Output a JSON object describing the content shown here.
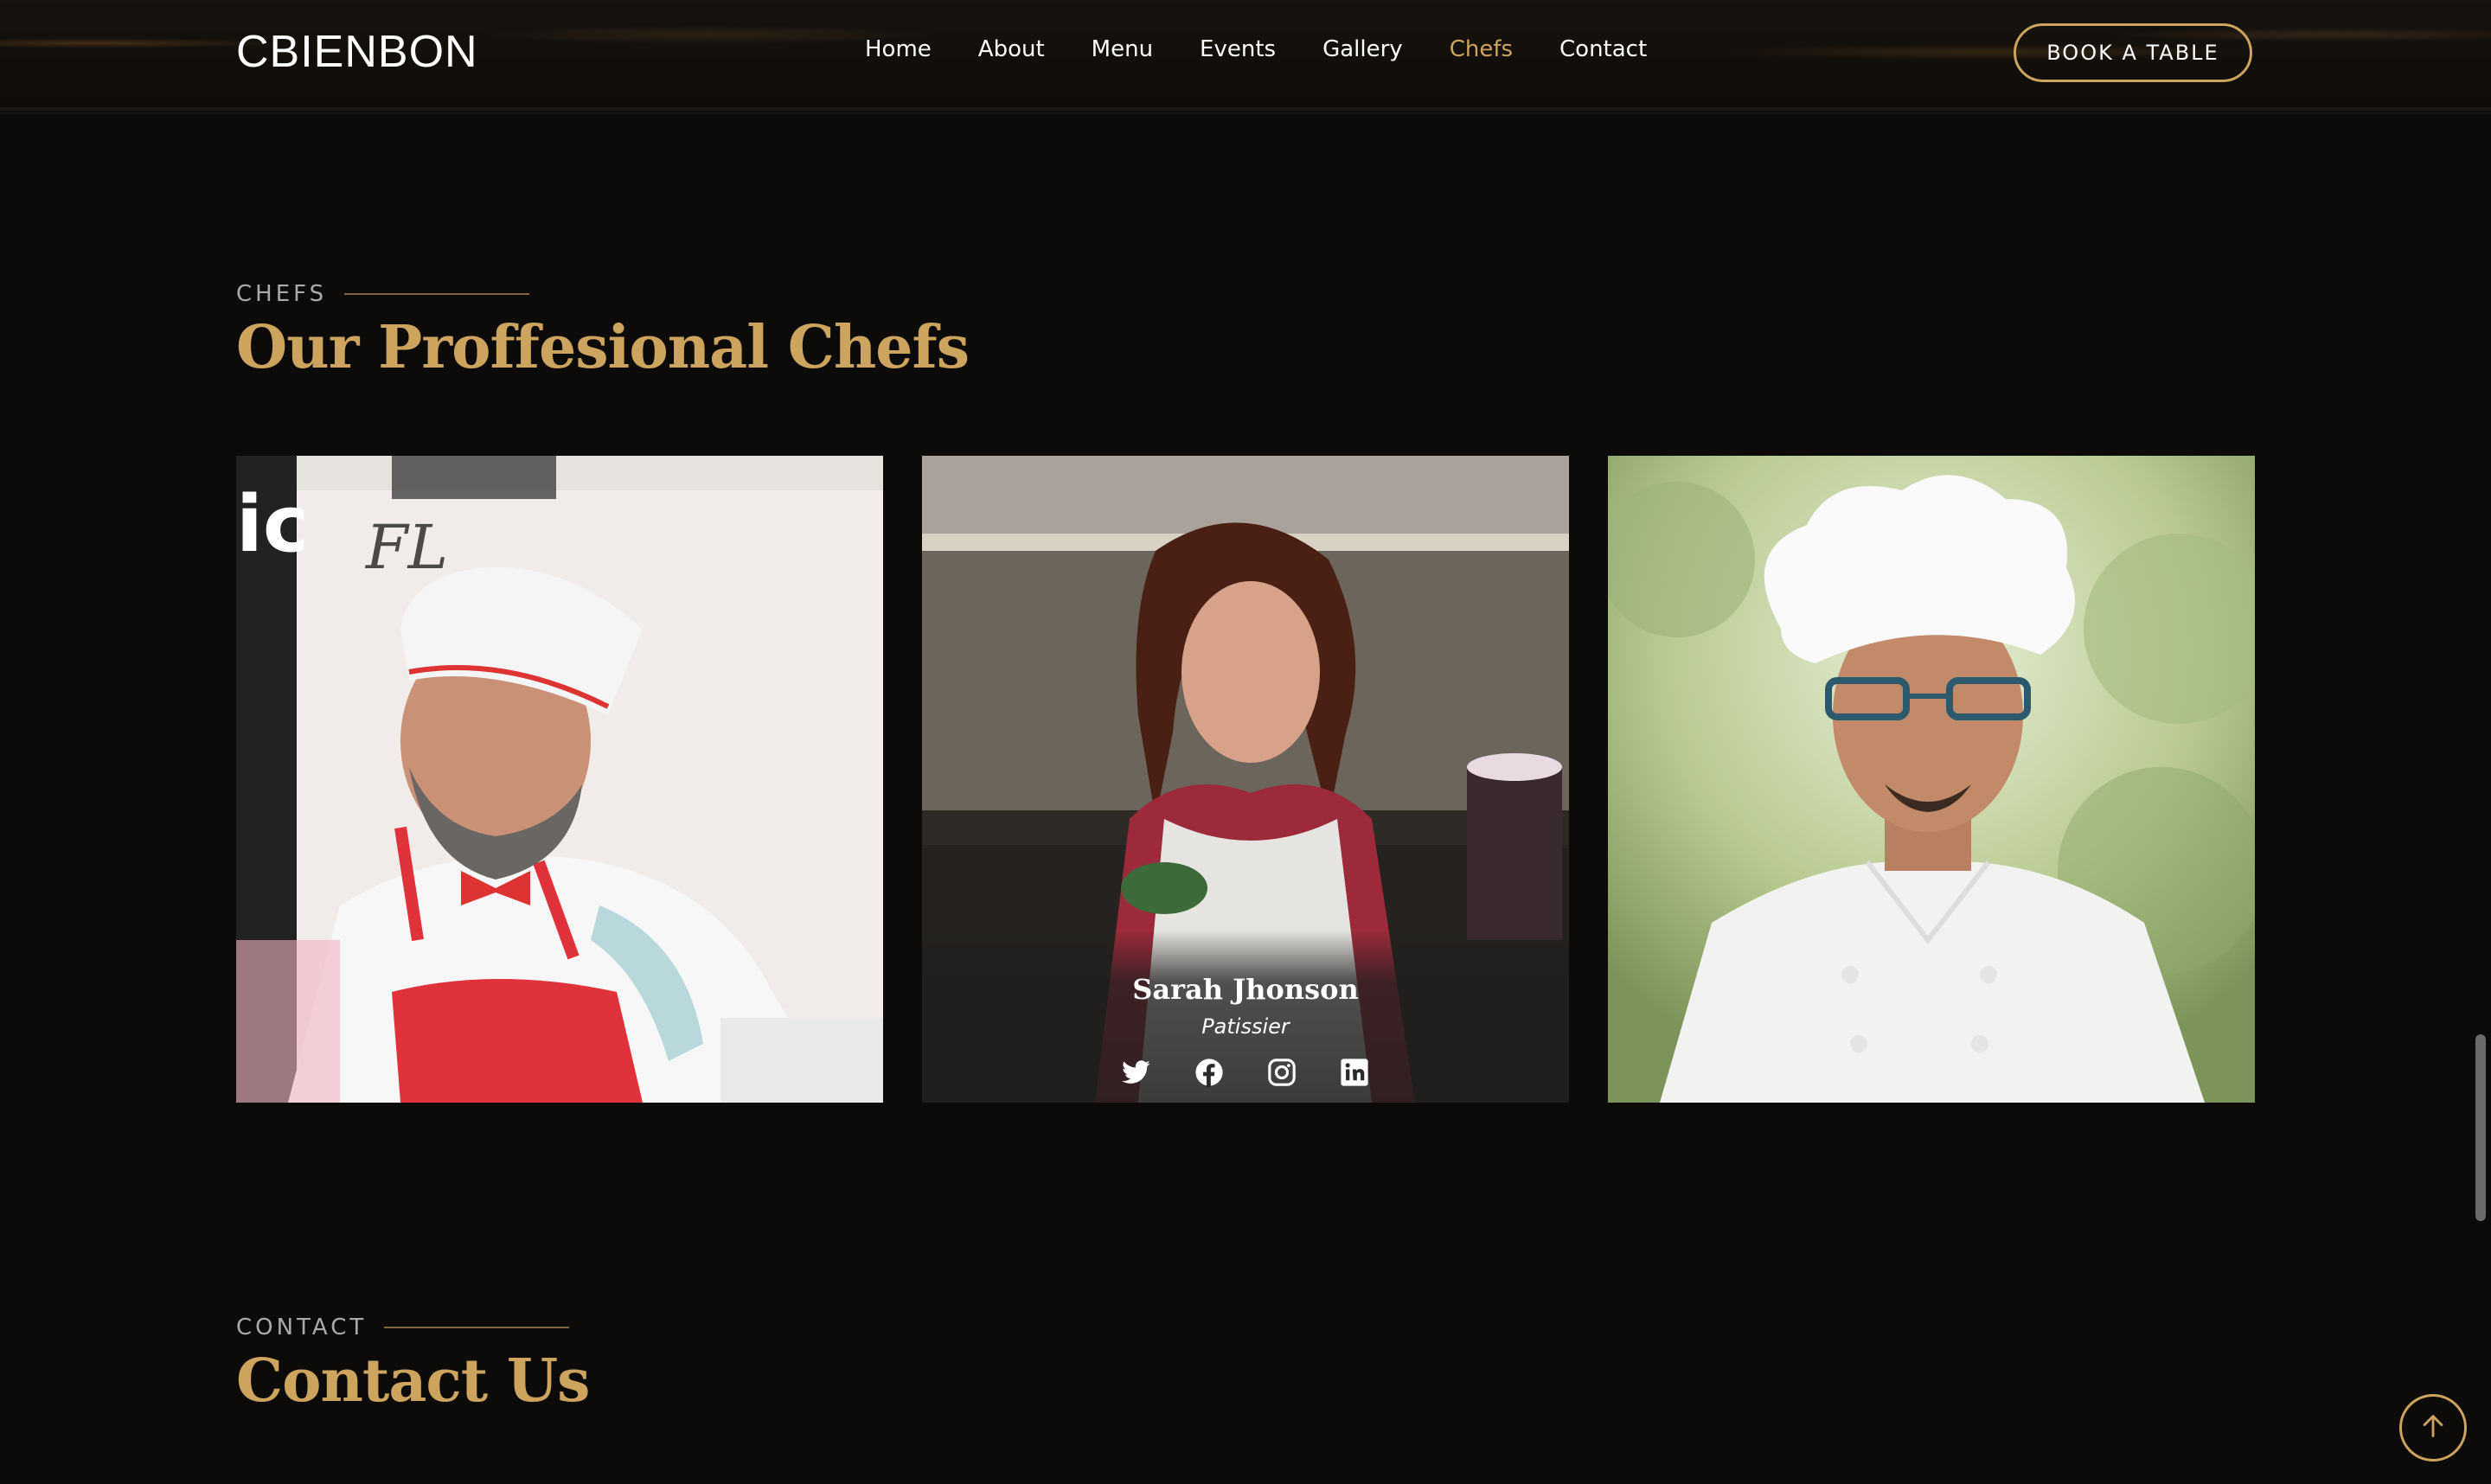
{
  "header": {
    "logo": "CBIENBON",
    "nav": [
      "Home",
      "About",
      "Menu",
      "Events",
      "Gallery",
      "Chefs",
      "Contact"
    ],
    "active_nav": "Chefs",
    "book_button": "BOOK A TABLE"
  },
  "chefs_section": {
    "eyebrow": "CHEFS",
    "title": "Our Proffesional Chefs",
    "chefs": [
      {
        "name": "",
        "role": ""
      },
      {
        "name": "Sarah Jhonson",
        "role": "Patissier",
        "socials": [
          "twitter-icon",
          "facebook-icon",
          "instagram-icon",
          "linkedin-icon"
        ]
      },
      {
        "name": "",
        "role": ""
      }
    ]
  },
  "contact_section": {
    "eyebrow": "CONTACT",
    "title": "Contact Us"
  },
  "colors": {
    "accent": "#cda45e",
    "background": "#0c0b09"
  }
}
